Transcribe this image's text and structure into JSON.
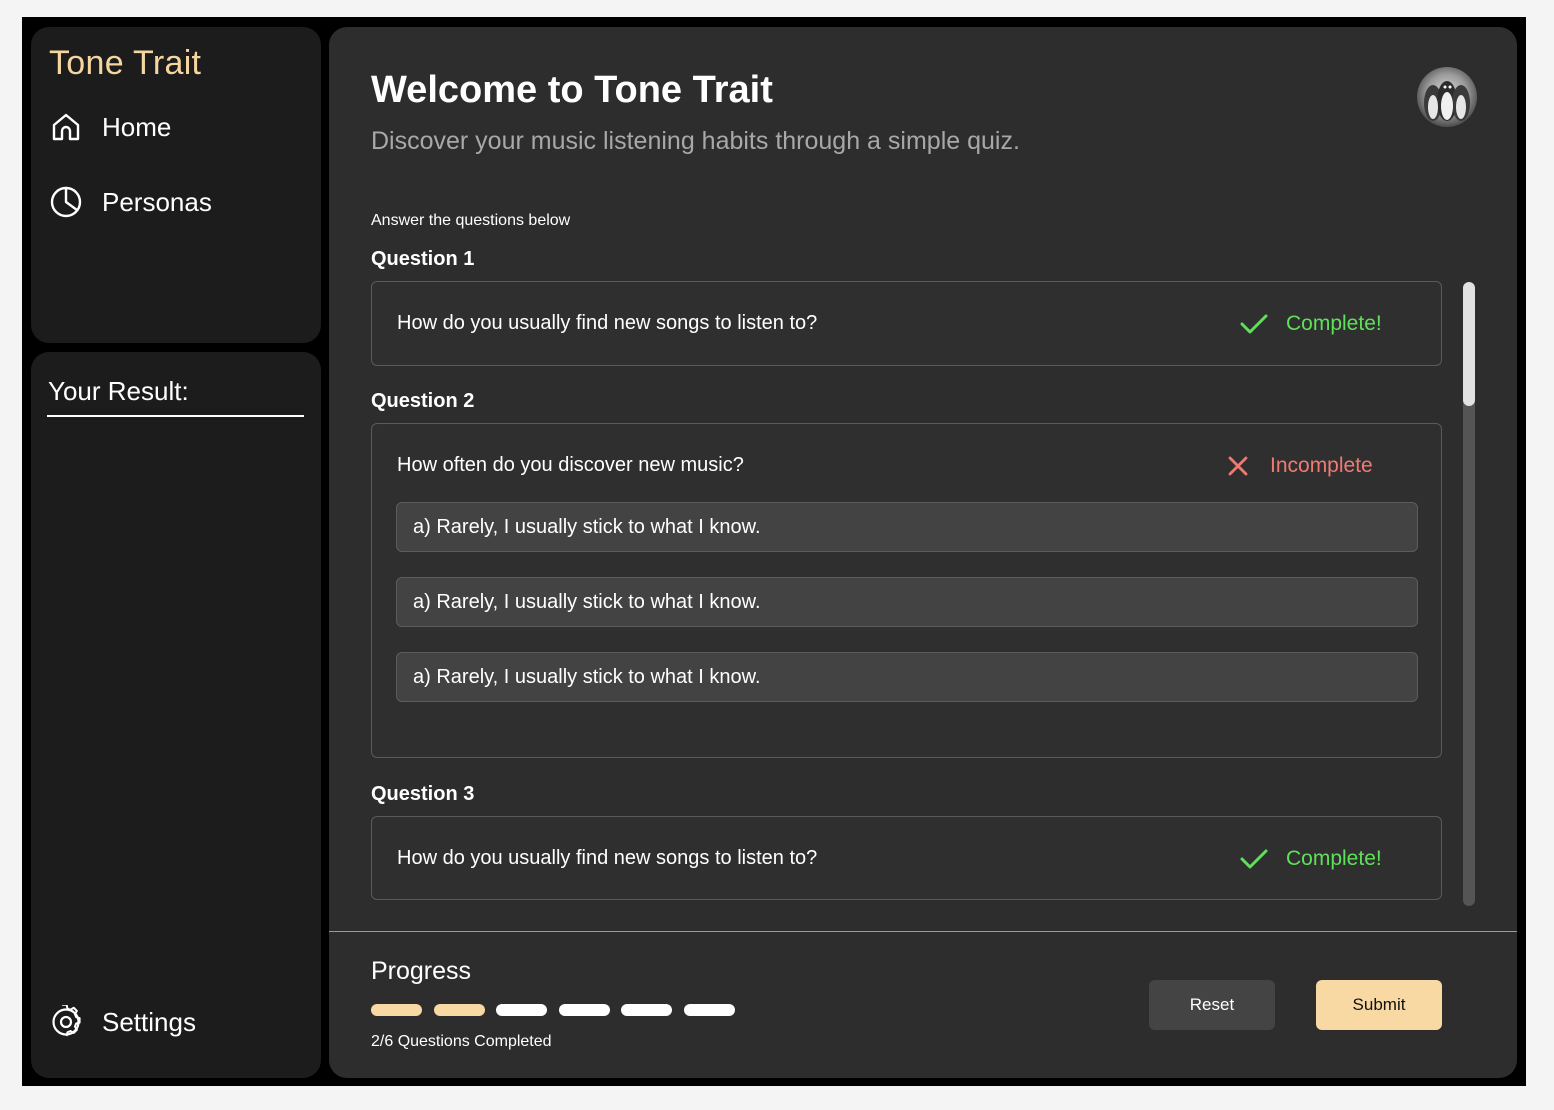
{
  "app": {
    "brand": "Tone Trait"
  },
  "sidebar": {
    "items": [
      {
        "label": "Home",
        "icon": "home-icon"
      },
      {
        "label": "Personas",
        "icon": "pie-chart-icon"
      }
    ],
    "result_title": "Your Result:",
    "settings_label": "Settings"
  },
  "header": {
    "title": "Welcome to Tone Trait",
    "subtitle": "Discover your music listening habits through a simple quiz."
  },
  "quiz": {
    "instructions": "Answer the questions below",
    "questions": [
      {
        "label": "Question 1",
        "text": "How do you usually find new songs to listen to?",
        "status": "Complete!"
      },
      {
        "label": "Question 2",
        "text": "How often do you discover new music?",
        "status": "Incomplete",
        "options": [
          "a) Rarely, I usually stick to what I know.",
          "a) Rarely, I usually stick to what I know.",
          "a) Rarely, I usually stick to what I know."
        ]
      },
      {
        "label": "Question 3",
        "text": "How do you usually find new songs to listen to?",
        "status": "Complete!"
      }
    ]
  },
  "progress": {
    "title": "Progress",
    "completed": 2,
    "total": 6,
    "summary": "2/6 Questions Completed"
  },
  "actions": {
    "reset_label": "Reset",
    "submit_label": "Submit"
  },
  "colors": {
    "accent": "#f9d9a3",
    "complete": "#5fe05a",
    "incomplete": "#f07a72",
    "panel": "#2d2d2d",
    "sidebar": "#1c1c1c"
  }
}
